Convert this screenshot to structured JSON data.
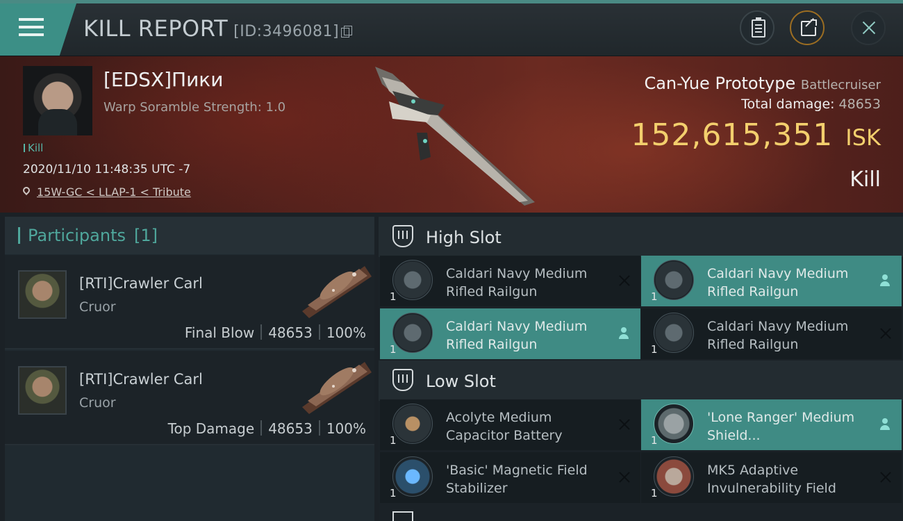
{
  "header": {
    "title": "KILL REPORT",
    "report_id": "[ID:3496081]",
    "icons": [
      "menu-icon",
      "copy-icon",
      "clipboard-icon",
      "share-icon",
      "close-icon"
    ]
  },
  "victim": {
    "name": "[EDSX]Пики",
    "scramble": "Warp Soramble Strength: 1.0",
    "tag": "Kill",
    "timestamp": "2020/11/10 11:48:35 UTC -7",
    "location": "15W-GC < LLAP-1 < Tribute"
  },
  "ship": {
    "name": "Can-Yue Prototype",
    "class": "Battlecruiser",
    "total_damage_label": "Total damage:",
    "total_damage": "48653",
    "isk_value": "152,615,351",
    "isk_unit": "ISK",
    "result": "Kill"
  },
  "participants": {
    "title": "Participants",
    "count": "[1]",
    "items": [
      {
        "name": "[RTI]Crawler Carl",
        "ship": "Cruor",
        "role": "Final Blow",
        "damage": "48653",
        "percent": "100%"
      },
      {
        "name": "[RTI]Crawler Carl",
        "ship": "Cruor",
        "role": "Top Damage",
        "damage": "48653",
        "percent": "100%"
      }
    ]
  },
  "slots": {
    "high": {
      "label": "High Slot",
      "modules": [
        {
          "qty": "1",
          "name": "Caldari Navy Medium Rifled Railgun",
          "highlight": false,
          "status": "destroyed"
        },
        {
          "qty": "1",
          "name": "Caldari Navy Medium Rifled Railgun",
          "highlight": true,
          "status": "dropped"
        },
        {
          "qty": "1",
          "name": "Caldari Navy Medium Rifled Railgun",
          "highlight": true,
          "status": "dropped"
        },
        {
          "qty": "1",
          "name": "Caldari Navy Medium Rifled Railgun",
          "highlight": false,
          "status": "destroyed"
        }
      ]
    },
    "low": {
      "label": "Low Slot",
      "modules": [
        {
          "qty": "1",
          "name": "Acolyte Medium Capacitor Battery",
          "highlight": false,
          "status": "destroyed"
        },
        {
          "qty": "1",
          "name": "'Lone Ranger' Medium Shield...",
          "highlight": true,
          "status": "dropped"
        },
        {
          "qty": "1",
          "name": "'Basic' Magnetic Field Stabilizer",
          "highlight": false,
          "status": "destroyed"
        },
        {
          "qty": "1",
          "name": "MK5 Adaptive Invulnerability Field",
          "highlight": false,
          "status": "destroyed"
        }
      ]
    }
  },
  "colors": {
    "accent_teal": "#3f8b84",
    "isk_gold": "#f3cf6d",
    "banner_red": "#5a231d"
  }
}
